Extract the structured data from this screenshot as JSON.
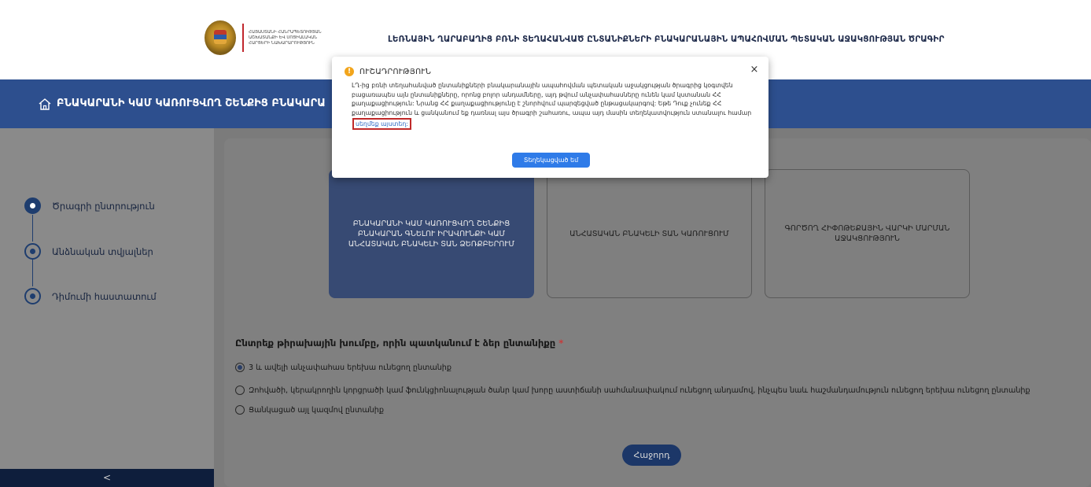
{
  "header": {
    "ministry_line1": "ԱՇԽԱՏԱՆՔԻ ԵՎ ՍՈՑԻԱԼԱԿԱՆ",
    "ministry_line2": "ՀԱՐՑԵՐԻ ՆԱԽԱՐԱՐՈՒԹՅՈՒՆ",
    "ministry_line0": "ՀԱՅԱՍՏԱՆԻ ՀԱՆՐԱՊԵՏՈՒԹՅԱՆ",
    "site_title": "ԼԵՌՆԱՅԻՆ ՂԱՐԱԲԱՂԻՑ ԲՌՆԻ ՏԵՂԱՀԱՆՎԱԾ ԸՆՏԱՆԻՔՆԵՐԻ ԲՆԱԿԱՐԱՆԱՅԻՆ ԱՊԱՀՈՎՄԱՆ ՊԵՏԱԿԱՆ ԱՋԱԿՑՈՒԹՅԱՆ ԾՐԱԳԻՐ"
  },
  "banner": {
    "title": "ԲՆԱԿԱՐԱՆԻ ԿԱՄ ԿԱՌՈՒՑՎՈՂ ՇԵՆՔԻՑ ԲՆԱԿԱՐԱ"
  },
  "sidebar": {
    "steps": [
      {
        "label": "Ծրագրի ընտրություն",
        "active": true
      },
      {
        "label": "Անձնական տվյալներ",
        "active": false
      },
      {
        "label": "Դիմումի հաստատում",
        "active": false
      }
    ],
    "collapse_label": "<"
  },
  "cards": [
    {
      "label": "ԲՆԱԿԱՐԱՆԻ ԿԱՄ ԿԱՌՈՒՑՎՈՂ ՇԵՆՔԻՑ ԲՆԱԿԱՐԱՆ ԳՆԵԼՈՒ ԻՐԱՎՈՒՆՔԻ ԿԱՄ ԱՆՀԱՏԱԿԱՆ ԲՆԱԿԵԼԻ ՏԱՆ ՁԵՌՔԲԵՐՈՒՄ",
      "selected": true
    },
    {
      "label": "ԱՆՀԱՏԱԿԱՆ ԲՆԱԿԵԼԻ ՏԱՆ ԿԱՌՈՒՑՈՒՄ",
      "selected": false
    },
    {
      "label": "ԳՈՐԾՈՂ ՀԻՓՈԹԵՔԱՅԻՆ ՎԱՐԿԻ ՄԱՐՄԱՆ ԱՋԱԿՑՈՒԹՅՈՒՆ",
      "selected": false
    }
  ],
  "question": {
    "text": "Ընտրեք թիրախային խումբը, որին պատկանում է ձեր ընտանիքը",
    "required_mark": "*",
    "options": [
      {
        "label": "3 և ավելի անչափահաս երեխա ունեցող ընտանիք",
        "checked": true
      },
      {
        "label": "Զոհվածի, կերակրողին կորցրածի կամ ֆունկցիոնալության ծանր կամ խորը աստիճանի սահմանափակում ունեցող անդամով, ինչպես նաև հաշմանդամություն ունեցող երեխա ունեցող ընտանիք",
        "checked": false
      },
      {
        "label": "Ցանկացած այլ կազմով ընտանիք",
        "checked": false
      }
    ]
  },
  "next_button": "Հաջորդ",
  "modal": {
    "title": "ՈՒՇԱԴՐՈՒԹՅՈՒՆ",
    "close": "×",
    "body_text": "ԼՂ-ից բռնի տեղահանված ընտանիքների բնակարանային ապահովման պետական աջակցության ծրագրից կօգտվեն բացառապես այն ընտանիքները, որոնց բոլոր անդամները, այդ թվում անչափահասները ունեն կամ կստանան ՀՀ քաղաքացիություն: Նրանց ՀՀ քաղաքացիությունը է շնորհվում պարզեցված ընթացակարգով: Եթե Դուք չունեք ՀՀ քաղաքացիություն և ցանկանում եք դառնալ այս ծրագրի շահառու, ապա այդ մասին տեղեկատվություն ստանալու համար",
    "link_text": "սեղմեք այստեղ:",
    "confirm_button": "Տեղեկացված եմ"
  },
  "colors": {
    "banner": "#2d4f8e",
    "selected_card": "#374a73",
    "confirm_button": "#2f7be8",
    "link_highlight": "#c02a2a",
    "warning": "#f2a51c"
  }
}
